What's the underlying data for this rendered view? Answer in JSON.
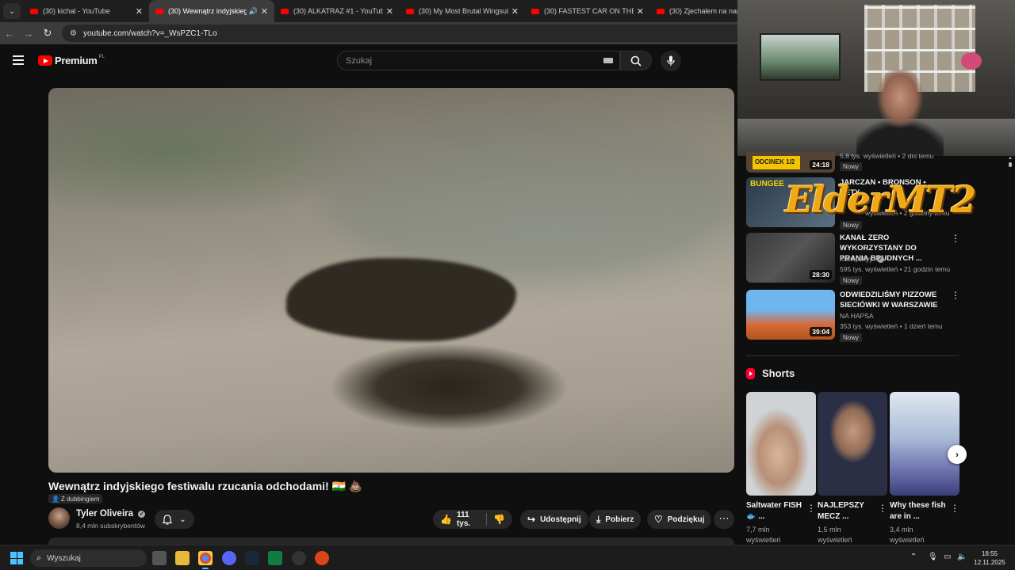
{
  "browser": {
    "tabs": [
      {
        "title": "(30) kichal - YouTube",
        "active": false
      },
      {
        "title": "(30) Wewnątrz indyjskiego f",
        "active": true
      },
      {
        "title": "(30) ALKATRAZ #1 - YouTube",
        "active": false
      },
      {
        "title": "(30) My Most Brutal Wingsuit F",
        "active": false
      },
      {
        "title": "(30) FASTEST CAR ON THE PLA",
        "active": false
      },
      {
        "title": "(30) Zjechałem na nartach",
        "active": false
      }
    ],
    "url": "youtube.com/watch?v=_WsPZC1-TLo"
  },
  "youtube": {
    "logo_text": "Premium",
    "logo_region": "PL",
    "search_placeholder": "Szukaj"
  },
  "video": {
    "title": "Wewnątrz indyjskiego festiwalu rzucania odchodami! 🇮🇳 💩",
    "dub_label": "Z dubbingiem",
    "channel": "Tyler Oliveira",
    "subscribers": "8,4 mln subskrybentów",
    "likes": "111 tys.",
    "share_label": "Udostępnij",
    "download_label": "Pobierz",
    "thanks_label": "Podziękuj"
  },
  "recommendations": [
    {
      "title": "",
      "channel": "",
      "meta": "5,8 tys. wyświetleń • 2 dni temu",
      "badge": "Nowy",
      "duration": "24:18",
      "episode": "ODCINEK 1/2"
    },
    {
      "title": "JARCZAN • BRONSON • BETY",
      "channel": "",
      "meta": "wyświetleń • 2 godziny temu",
      "badge": "Nowy",
      "duration": "",
      "episode": "BUNGEE"
    },
    {
      "title": "KANAŁ ZERO WYKORZYSTANY DO PRANIA BRUDNYCH ...",
      "channel": "Konopskyy",
      "meta": "595 tys. wyświetleń • 21 godzin temu",
      "badge": "Nowy",
      "duration": "28:30"
    },
    {
      "title": "ODWIEDZILIŚMY PIZZOWE SIECIÓWKI W WARSZAWIE",
      "channel": "NA HAPSA",
      "meta": "353 tys. wyświetleń • 1 dzień temu",
      "badge": "Nowy",
      "duration": "39:04"
    }
  ],
  "overlay": {
    "stream_logo": "ElderMT2"
  },
  "shorts": {
    "heading": "Shorts",
    "items": [
      {
        "title": "Saltwater FISH 🐟 ...",
        "views": "7,7 mln wyświetleń"
      },
      {
        "title": "NAJLEPSZY MECZ ...",
        "views": "1,5 mln wyświetleń"
      },
      {
        "title": "Why these fish are in ...",
        "views": "3,4 mln wyświetleń"
      }
    ]
  },
  "taskbar": {
    "search_label": "Wyszukaj",
    "time": "18:55",
    "date": "12.11.2025"
  }
}
